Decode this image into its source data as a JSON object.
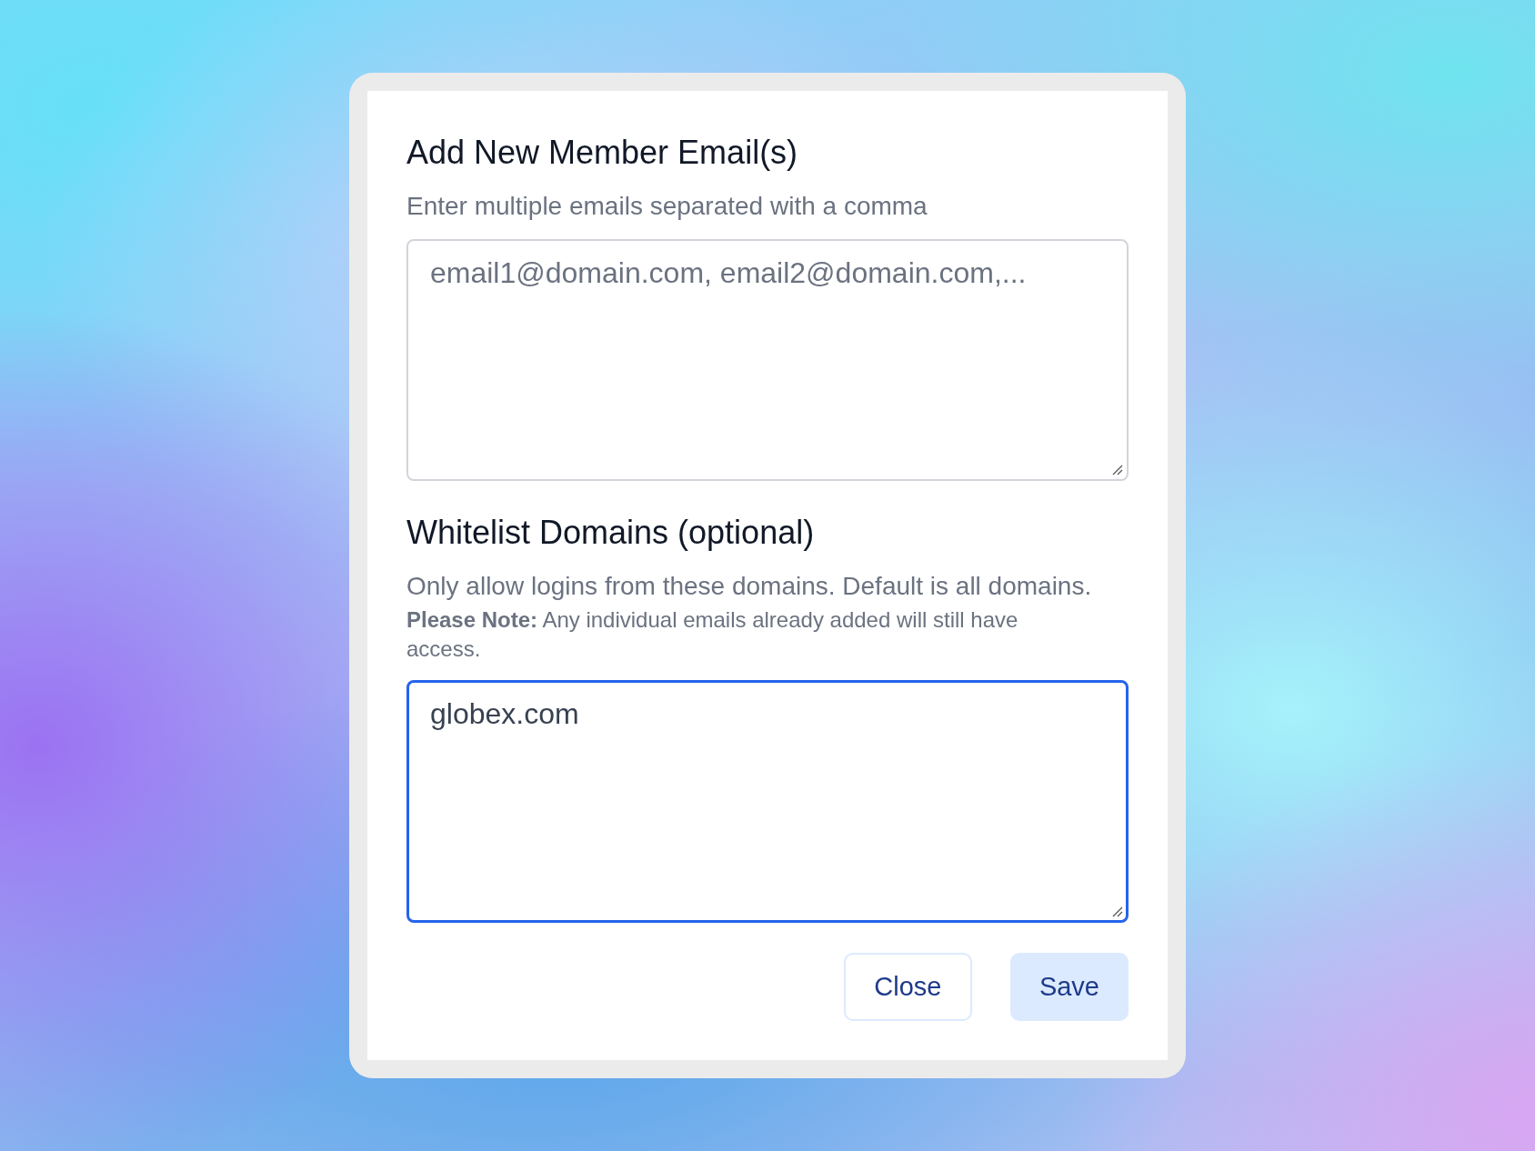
{
  "dialog": {
    "sections": [
      {
        "title": "Add New Member Email(s)",
        "descriptions": [
          {
            "kind": "hint",
            "text": "Enter multiple emails separated with a comma"
          }
        ],
        "field": {
          "placeholder": "email1@domain.com, email2@domain.com,...",
          "focused": false
        }
      },
      {
        "title": "Whitelist Domains (optional)",
        "descriptions": [
          {
            "kind": "hint",
            "text": "Only allow logins from these domains. Default is all domains."
          },
          {
            "kind": "note",
            "text": "**Please Note:** Any individual emails already added will still have access."
          }
        ],
        "field": {
          "value": "globex.com",
          "focused": true
        }
      }
    ],
    "buttons": [
      {
        "label": "Close",
        "kind": "secondary"
      },
      {
        "label": "Save",
        "kind": "primary"
      }
    ]
  }
}
